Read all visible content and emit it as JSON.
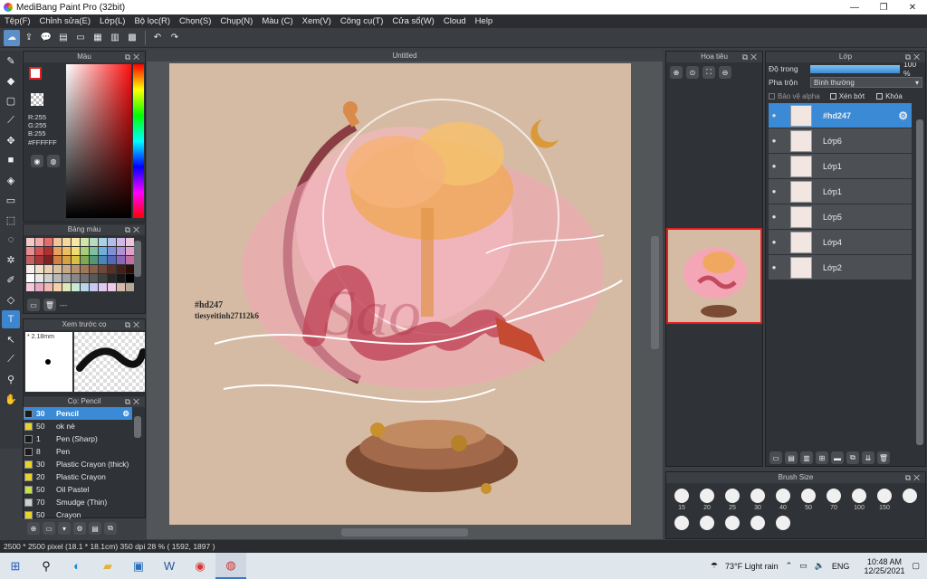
{
  "title": "MediBang Paint Pro (32bit)",
  "window_controls": [
    "—",
    "❐",
    "✕"
  ],
  "menu": [
    "Tệp(F)",
    "Chỉnh sửa(E)",
    "Lớp(L)",
    "Bộ lọc(R)",
    "Chọn(S)",
    "Chụp(N)",
    "Màu (C)",
    "Xem(V)",
    "Công cụ(T)",
    "Cửa sổ(W)",
    "Cloud",
    "Help"
  ],
  "color_panel": {
    "title": "Màu",
    "rgb_r": "R:255",
    "rgb_g": "G:255",
    "rgb_b": "B:255",
    "hex": "#FFFFFF"
  },
  "palette_panel": {
    "title": "Bảng màu",
    "extra": "---"
  },
  "preview_panel": {
    "title": "Xem trước cọ",
    "size": "* 2.18mm"
  },
  "brush_panel": {
    "title": "Cọ: Pencil",
    "items": [
      {
        "size": "30",
        "name": "Pencil",
        "color": "#1a1a1a",
        "selected": true
      },
      {
        "size": "50",
        "name": "ok nè",
        "color": "#e8d428"
      },
      {
        "size": "1",
        "name": "Pen (Sharp)",
        "color": "#1a1a1a"
      },
      {
        "size": "8",
        "name": "Pen",
        "color": "#1a1a1a"
      },
      {
        "size": "30",
        "name": "Plastic Crayon (thick)",
        "color": "#e8d428"
      },
      {
        "size": "20",
        "name": "Plastic Crayon",
        "color": "#e8d428"
      },
      {
        "size": "50",
        "name": "Oil Pastel",
        "color": "#c8e048"
      },
      {
        "size": "70",
        "name": "Smudge (Thin)",
        "color": "#cfcfcf"
      },
      {
        "size": "50",
        "name": "Crayon",
        "color": "#e8d428"
      }
    ]
  },
  "canvas": {
    "tab": "Untitled",
    "watermark_1": "#hd247",
    "watermark_2": "tiesyeitinh27112k6",
    "art_text": "Sao"
  },
  "navigator": {
    "title": "Hoa tiêu"
  },
  "layers_panel": {
    "title": "Lớp",
    "opacity_label": "Độ trong",
    "opacity_value": "100 %",
    "opacity": 1.0,
    "blend_label": "Pha trộn",
    "blend_value": "Bình thường",
    "protect_alpha": "Bảo vệ alpha",
    "clip": "Xén bớt",
    "lock": "Khóa",
    "layers": [
      {
        "name": "#hd247",
        "selected": true
      },
      {
        "name": "Lớp6"
      },
      {
        "name": "Lớp1"
      },
      {
        "name": "Lớp1"
      },
      {
        "name": "Lớp5"
      },
      {
        "name": "Lớp4"
      },
      {
        "name": "Lớp2"
      }
    ]
  },
  "brush_size": {
    "title": "Brush Size",
    "sizes": [
      "15",
      "20",
      "25",
      "30",
      "40",
      "50",
      "70",
      "100",
      "150"
    ]
  },
  "status": "2500 * 2500 pixel  (18.1 * 18.1cm)  350 dpi   28 %  ( 1592, 1897 )",
  "taskbar": {
    "weather": "73°F  Light rain",
    "lang": "ENG",
    "time": "10:48 AM",
    "date": "12/25/2021"
  },
  "colors": {
    "accent": "#3a8ad6",
    "canvas_bg": "#d6bba4"
  }
}
